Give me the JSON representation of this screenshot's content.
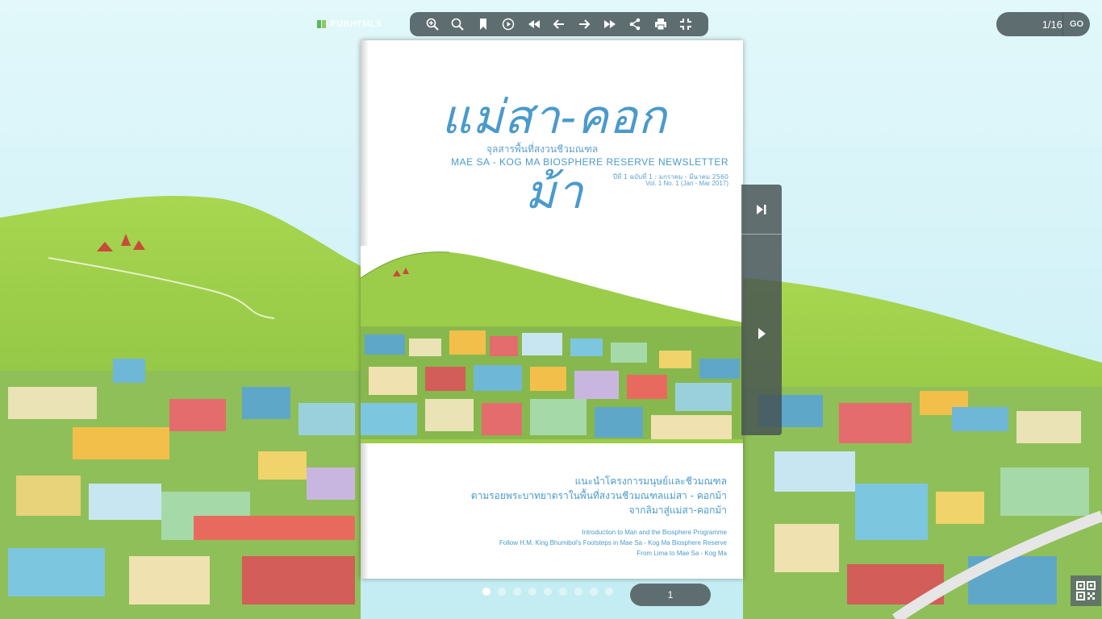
{
  "logo": {
    "text": "PUBHTML5"
  },
  "toolbar": {
    "buttons": [
      {
        "name": "zoom-in-button",
        "icon": "zoom-in-icon"
      },
      {
        "name": "search-button",
        "icon": "search-icon"
      },
      {
        "name": "bookmark-button",
        "icon": "bookmark-icon"
      },
      {
        "name": "autoplay-button",
        "icon": "play-circle-icon"
      },
      {
        "name": "first-page-button",
        "icon": "fast-backward-icon"
      },
      {
        "name": "previous-page-button",
        "icon": "arrow-left-icon"
      },
      {
        "name": "next-page-button",
        "icon": "arrow-right-icon"
      },
      {
        "name": "last-page-button",
        "icon": "fast-forward-icon"
      },
      {
        "name": "share-button",
        "icon": "share-icon"
      },
      {
        "name": "print-button",
        "icon": "print-icon"
      },
      {
        "name": "fullscreen-button",
        "icon": "fullscreen-icon"
      }
    ]
  },
  "goto": {
    "value": "1/16",
    "button_label": "GO"
  },
  "page": {
    "title_th": "แม่สา-คอกม้า",
    "subtitle_th": "จุลสารพื้นที่สงวนชีวมณฑล",
    "subtitle_en": "MAE SA - KOG MA BIOSPHERE RESERVE NEWSLETTER",
    "volume_th": "ปีที่ 1 ฉบับที่ 1 : มกราคม - มีนาคม 2560",
    "volume_en": "Vol. 1 No. 1 (Jan - Mar 2017)",
    "topics_th": [
      "แนะนำโครงการมนุษย์และชีวมณฑล",
      "ตามรอยพระบาทยาตราในพื้นที่สงวนชีวมณฑลแม่สา - คอกม้า",
      "จากลิมาสู่แม่สา-คอกม้า"
    ],
    "topics_en": [
      "Introduction to Man and the Biosphere Programme",
      "Follow H.M. King Bhumibol's Footsteps in Mae Sa - Kog Ma Biosphere Reserve",
      "From Lima to Mae Sa - Kog Ma"
    ]
  },
  "bottom": {
    "page_indicator": "1",
    "dot_count": 9,
    "active_dot": 0
  },
  "colors": {
    "toolbar_bg": "#5e6e70",
    "accent_blue": "#4a9acb",
    "hill_green": "#9ccd4a"
  }
}
